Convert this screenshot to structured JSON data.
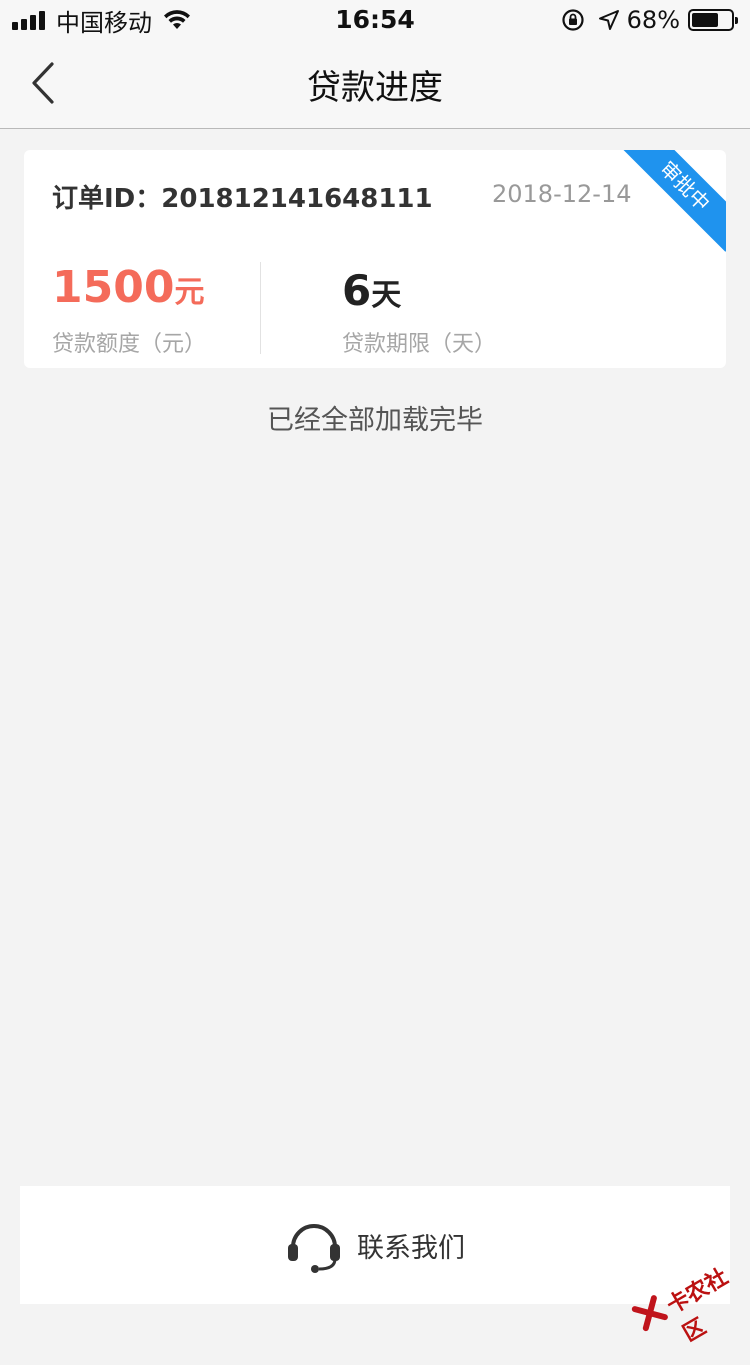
{
  "status_bar": {
    "carrier": "中国移动",
    "time": "16:54",
    "battery_percent": "68%",
    "battery_level": 0.68
  },
  "nav": {
    "title": "贷款进度"
  },
  "order": {
    "id_label": "订单ID：201812141648111",
    "date": "2018-12-14",
    "status_badge": "审批中",
    "amount_value": "1500",
    "amount_unit": "元",
    "amount_label": "贷款额度（元）",
    "term_value": "6",
    "term_unit": "天",
    "term_label": "贷款期限（天）"
  },
  "list_footer": "已经全部加载完毕",
  "contact": {
    "label": "联系我们"
  },
  "watermark": "卡农社区",
  "colors": {
    "accent_blue": "#1f93ee",
    "amount_red": "#f46b5a",
    "background": "#f3f3f3"
  },
  "icons": [
    "back-chevron-icon",
    "headset-icon",
    "wifi-icon",
    "signal-icon",
    "location-arrow-icon",
    "rotation-lock-icon",
    "battery-icon"
  ]
}
